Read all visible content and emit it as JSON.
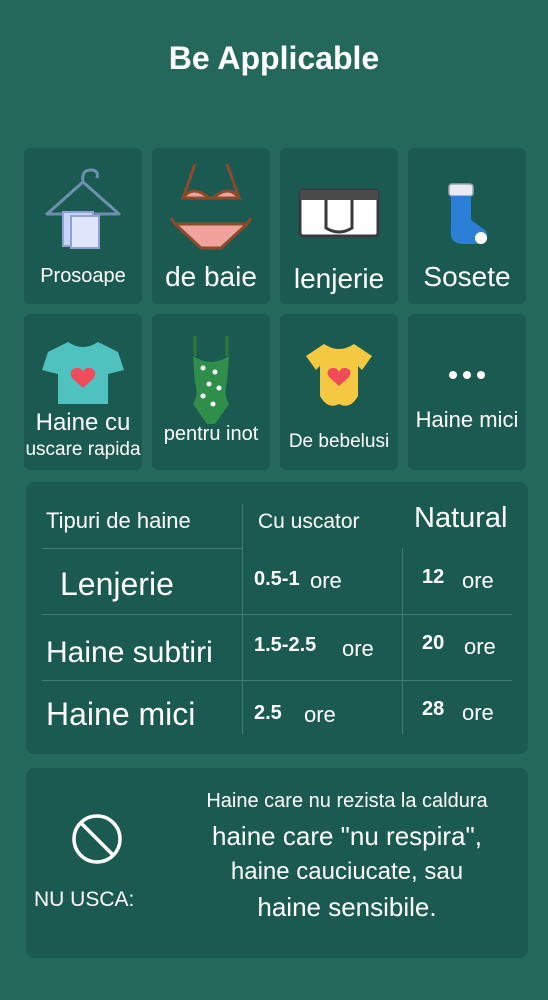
{
  "title": "Be Applicable",
  "categories": [
    {
      "label_lines": [
        "Prosoape"
      ],
      "icon": "hanger-towel-icon"
    },
    {
      "label_lines": [
        "de baie"
      ],
      "icon": "bikini-icon"
    },
    {
      "label_lines": [
        "lenjerie"
      ],
      "icon": "underwear-icon"
    },
    {
      "label_lines": [
        "Sosete"
      ],
      "icon": "sock-icon"
    },
    {
      "label_lines": [
        "Haine cu",
        "uscare rapida"
      ],
      "icon": "tshirt-heart-icon"
    },
    {
      "label_lines": [
        "pentru inot"
      ],
      "icon": "swimsuit-icon"
    },
    {
      "label_lines": [
        "De bebelusi"
      ],
      "icon": "baby-bodysuit-icon"
    },
    {
      "label_lines": [
        "Haine mici"
      ],
      "icon": "more-dots-icon"
    }
  ],
  "drying_table": {
    "headers": [
      "Tipuri de haine",
      "Cu uscator",
      "Natural"
    ],
    "rows": [
      {
        "type": "Lenjerie",
        "dryer_value": "0.5-1",
        "dryer_unit": "ore",
        "natural_value": "12",
        "natural_unit": "ore"
      },
      {
        "type": "Haine subtiri",
        "dryer_value": "1.5-2.5",
        "dryer_unit": "ore",
        "natural_value": "20",
        "natural_unit": "ore"
      },
      {
        "type": "Haine mici",
        "dryer_value": "2.5",
        "dryer_unit": "ore",
        "natural_value": "28",
        "natural_unit": "ore"
      }
    ]
  },
  "warning": {
    "icon": "prohibited-icon",
    "label": "NU USCA:",
    "lines": [
      "Haine care nu rezista la caldura",
      "haine care \"nu respira\",",
      "haine cauciucate, sau",
      "haine sensibile."
    ]
  },
  "colors": {
    "background": "#24685c",
    "panel": "#1b5a51",
    "text": "#ffffff"
  }
}
